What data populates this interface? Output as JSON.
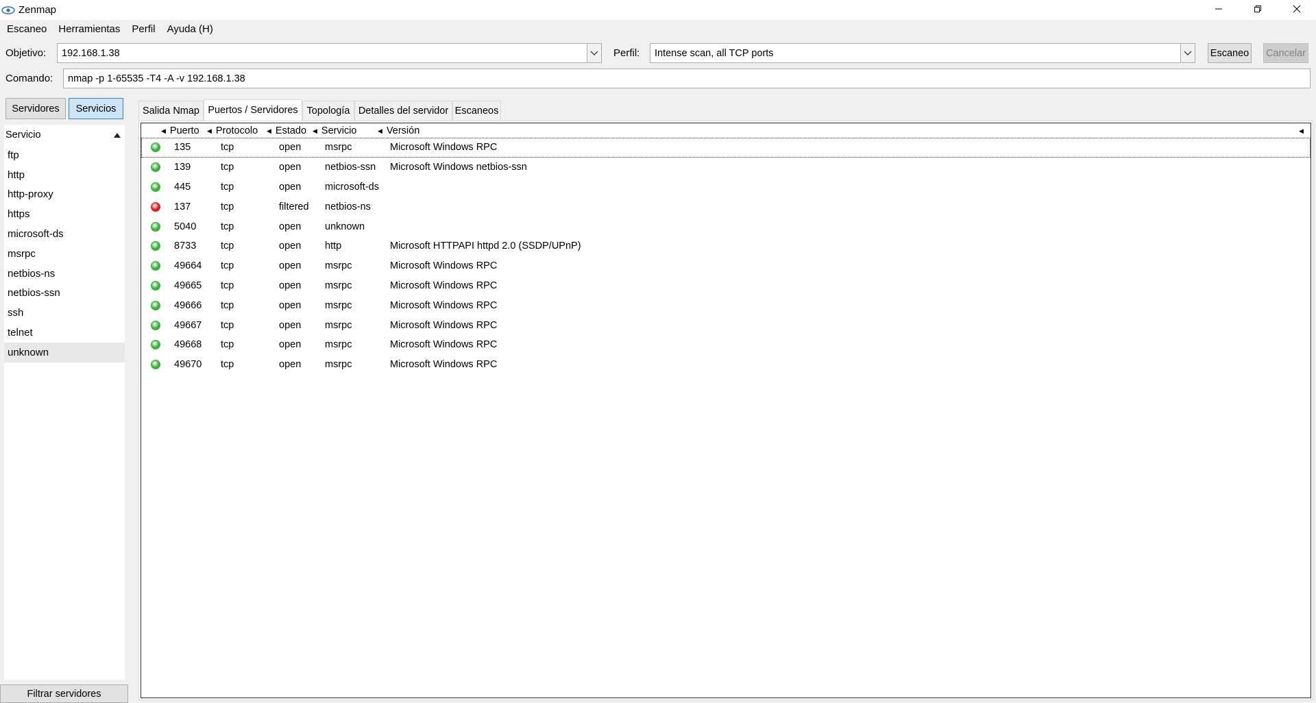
{
  "window": {
    "title": "Zenmap",
    "controls": [
      "minimize",
      "restore",
      "close"
    ]
  },
  "menubar": {
    "items": [
      "Escaneo",
      "Herramientas",
      "Perfil",
      "Ayuda (H)"
    ]
  },
  "target": {
    "label": "Objetivo:",
    "value": "192.168.1.38"
  },
  "profile": {
    "label": "Perfil:",
    "value": "Intense scan, all TCP ports"
  },
  "buttons": {
    "scan": "Escaneo",
    "cancel": "Cancelar",
    "filter_hosts": "Filtrar servidores"
  },
  "command": {
    "label": "Comando:",
    "value": "nmap -p 1-65535 -T4 -A -v 192.168.1.38"
  },
  "sidebar": {
    "toggle": [
      "Servidores",
      "Servicios"
    ],
    "active_toggle": "Servicios",
    "header": "Servicio",
    "items": [
      "ftp",
      "http",
      "http-proxy",
      "https",
      "microsoft-ds",
      "msrpc",
      "netbios-ns",
      "netbios-ssn",
      "ssh",
      "telnet",
      "unknown"
    ],
    "selected": "unknown"
  },
  "tabs": {
    "items": [
      "Salida Nmap",
      "Puertos / Servidores",
      "Topología",
      "Detalles del servidor",
      "Escaneos"
    ],
    "active": "Puertos / Servidores"
  },
  "ports_table": {
    "columns": [
      "Puerto",
      "Protocolo",
      "Estado",
      "Servicio",
      "Versión"
    ],
    "status_colors": {
      "open": "#3dae3d",
      "filtered": "#d42020"
    },
    "rows": [
      {
        "port": "135",
        "protocol": "tcp",
        "state": "open",
        "service": "msrpc",
        "version": "Microsoft Windows RPC"
      },
      {
        "port": "139",
        "protocol": "tcp",
        "state": "open",
        "service": "netbios-ssn",
        "version": "Microsoft Windows netbios-ssn"
      },
      {
        "port": "445",
        "protocol": "tcp",
        "state": "open",
        "service": "microsoft-ds",
        "version": ""
      },
      {
        "port": "137",
        "protocol": "tcp",
        "state": "filtered",
        "service": "netbios-ns",
        "version": ""
      },
      {
        "port": "5040",
        "protocol": "tcp",
        "state": "open",
        "service": "unknown",
        "version": ""
      },
      {
        "port": "8733",
        "protocol": "tcp",
        "state": "open",
        "service": "http",
        "version": "Microsoft HTTPAPI httpd 2.0 (SSDP/UPnP)"
      },
      {
        "port": "49664",
        "protocol": "tcp",
        "state": "open",
        "service": "msrpc",
        "version": "Microsoft Windows RPC"
      },
      {
        "port": "49665",
        "protocol": "tcp",
        "state": "open",
        "service": "msrpc",
        "version": "Microsoft Windows RPC"
      },
      {
        "port": "49666",
        "protocol": "tcp",
        "state": "open",
        "service": "msrpc",
        "version": "Microsoft Windows RPC"
      },
      {
        "port": "49667",
        "protocol": "tcp",
        "state": "open",
        "service": "msrpc",
        "version": "Microsoft Windows RPC"
      },
      {
        "port": "49668",
        "protocol": "tcp",
        "state": "open",
        "service": "msrpc",
        "version": "Microsoft Windows RPC"
      },
      {
        "port": "49670",
        "protocol": "tcp",
        "state": "open",
        "service": "msrpc",
        "version": "Microsoft Windows RPC"
      }
    ]
  }
}
